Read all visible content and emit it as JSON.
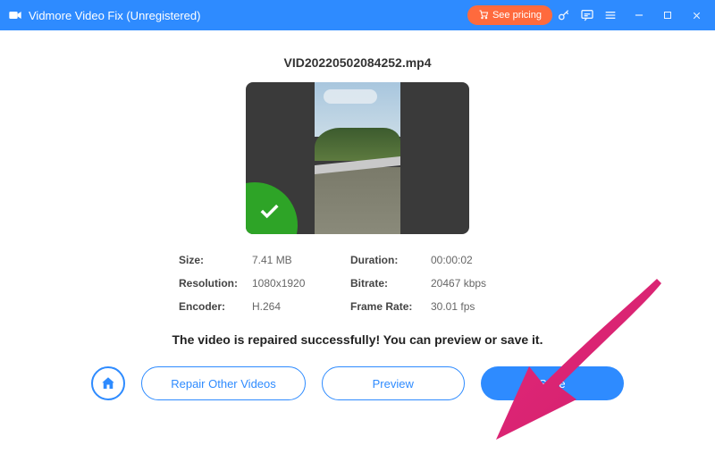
{
  "titlebar": {
    "app_title": "Vidmore Video Fix (Unregistered)",
    "pricing_label": "See pricing"
  },
  "file": {
    "name": "VID20220502084252.mp4"
  },
  "info": {
    "size_label": "Size:",
    "size_value": "7.41 MB",
    "duration_label": "Duration:",
    "duration_value": "00:00:02",
    "resolution_label": "Resolution:",
    "resolution_value": "1080x1920",
    "bitrate_label": "Bitrate:",
    "bitrate_value": "20467 kbps",
    "encoder_label": "Encoder:",
    "encoder_value": "H.264",
    "framerate_label": "Frame Rate:",
    "framerate_value": "30.01 fps"
  },
  "status": {
    "message": "The video is repaired successfully! You can preview or save it."
  },
  "buttons": {
    "repair_other": "Repair Other Videos",
    "preview": "Preview",
    "save": "Save"
  }
}
